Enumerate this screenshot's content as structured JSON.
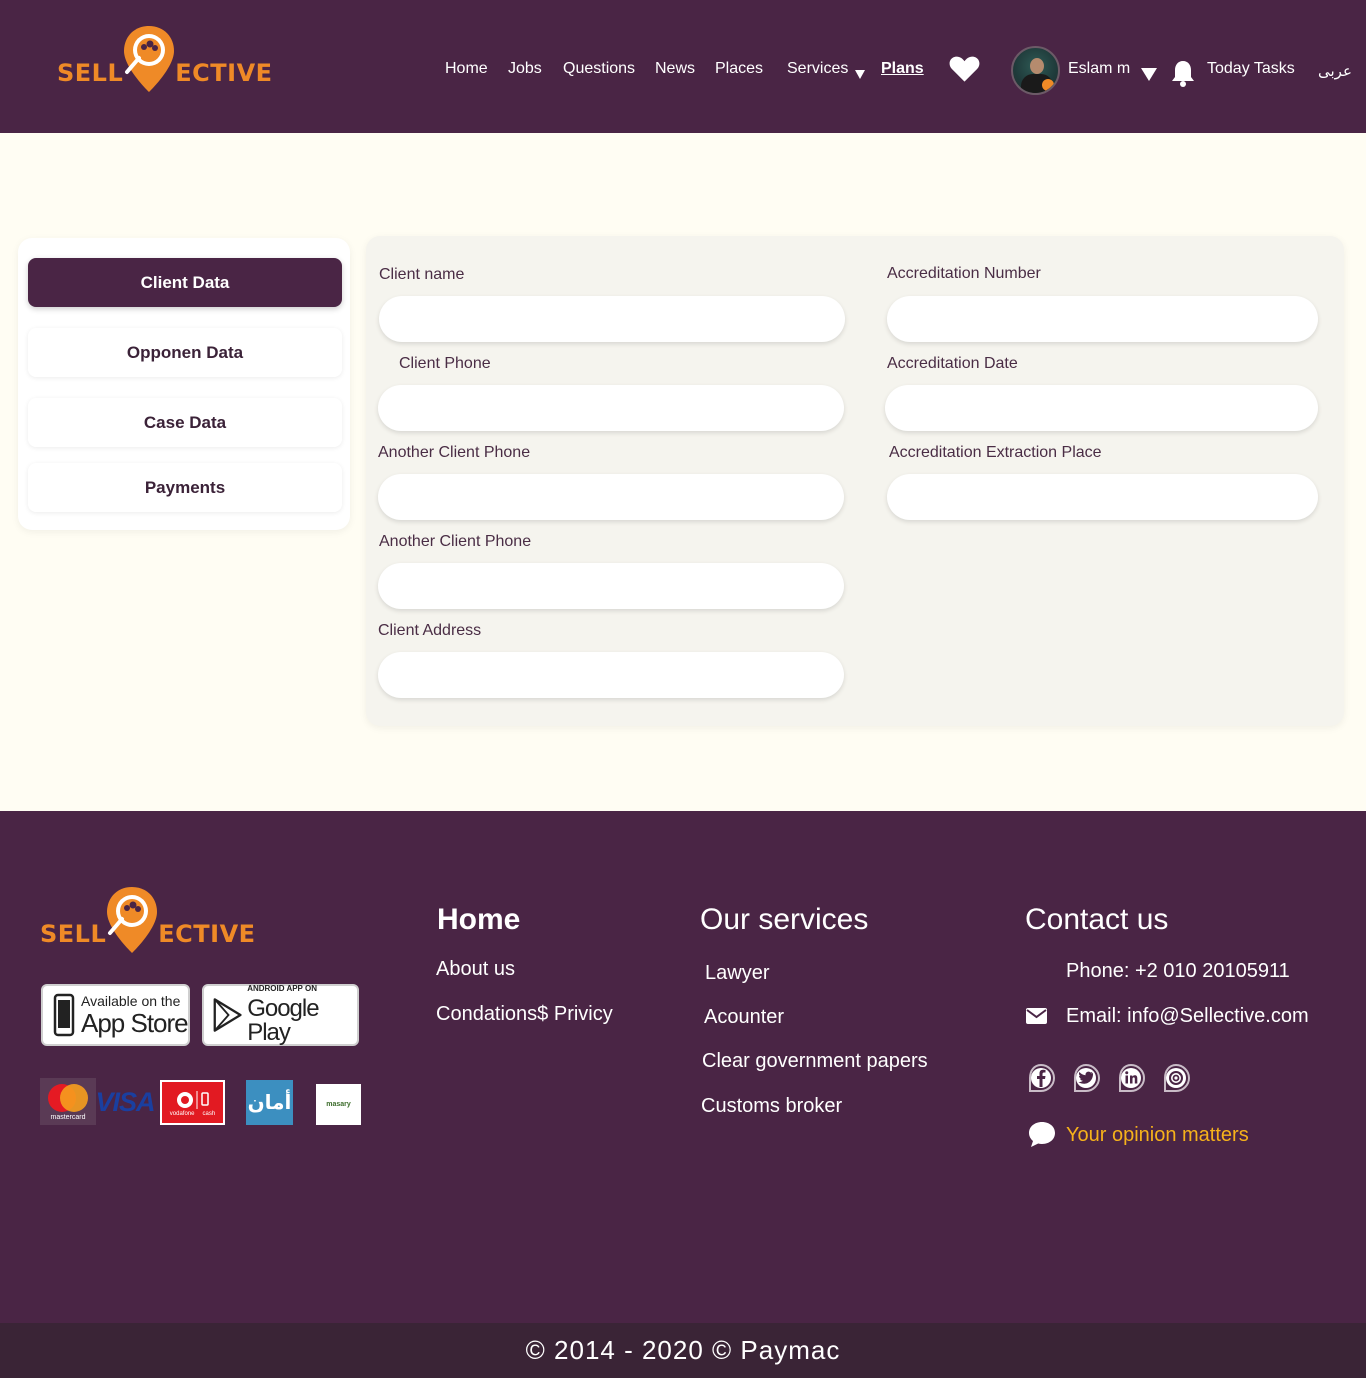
{
  "brand": {
    "left": "SELL",
    "right": "ECTIVE",
    "color": "#ef8a27"
  },
  "nav": {
    "home": "Home",
    "jobs": "Jobs",
    "questions": "Questions",
    "news": "News",
    "places": "Places",
    "services": "Services",
    "plans": "Plans",
    "user_name": "Eslam m",
    "today_tasks": "Today Tasks",
    "language": "عربى"
  },
  "sidebar": {
    "items": [
      {
        "label": "Client Data",
        "active": true
      },
      {
        "label": "Opponen Data",
        "active": false
      },
      {
        "label": "Case Data",
        "active": false
      },
      {
        "label": "Payments",
        "active": false
      }
    ]
  },
  "form": {
    "client_name": {
      "label": "Client name",
      "value": ""
    },
    "client_phone": {
      "label": "Client Phone",
      "value": ""
    },
    "another_phone_1": {
      "label": "Another Client Phone",
      "value": ""
    },
    "another_phone_2": {
      "label": "Another Client Phone",
      "value": ""
    },
    "client_address": {
      "label": "Client Address",
      "value": ""
    },
    "accreditation_number": {
      "label": "Accreditation Number",
      "value": ""
    },
    "accreditation_date": {
      "label": "Accreditation Date",
      "value": ""
    },
    "accreditation_place": {
      "label": "Accreditation Extraction Place",
      "value": ""
    }
  },
  "footer": {
    "stores": {
      "appstore_top": "Available on the",
      "appstore_main": "App Store",
      "google_top": "ANDROID APP ON",
      "google_main": "Google Play"
    },
    "payments": {
      "mastercard": "mastercard",
      "visa": "VISA",
      "vodafone": "vodafone",
      "cash": "cash",
      "aman": "أمان",
      "masary": "masary"
    },
    "home_col": {
      "title": "Home",
      "links": [
        "About us",
        "Condations$ Privicy"
      ]
    },
    "services_col": {
      "title": "Our services",
      "links": [
        "Lawyer",
        "Acounter",
        "Clear government papers",
        "Customs broker"
      ]
    },
    "contact_col": {
      "title": "Contact us",
      "phone": "Phone: +2 010 20105911",
      "email": "Email: info@Sellective.com",
      "opinion": "Your opinion matters",
      "opinion_color": "#f6b21b"
    },
    "copyright": "© 2014 - 2020 © Paymac"
  },
  "colors": {
    "primary": "#4a2545",
    "background": "#fffdf3",
    "form_background": "#f5f4ee"
  }
}
